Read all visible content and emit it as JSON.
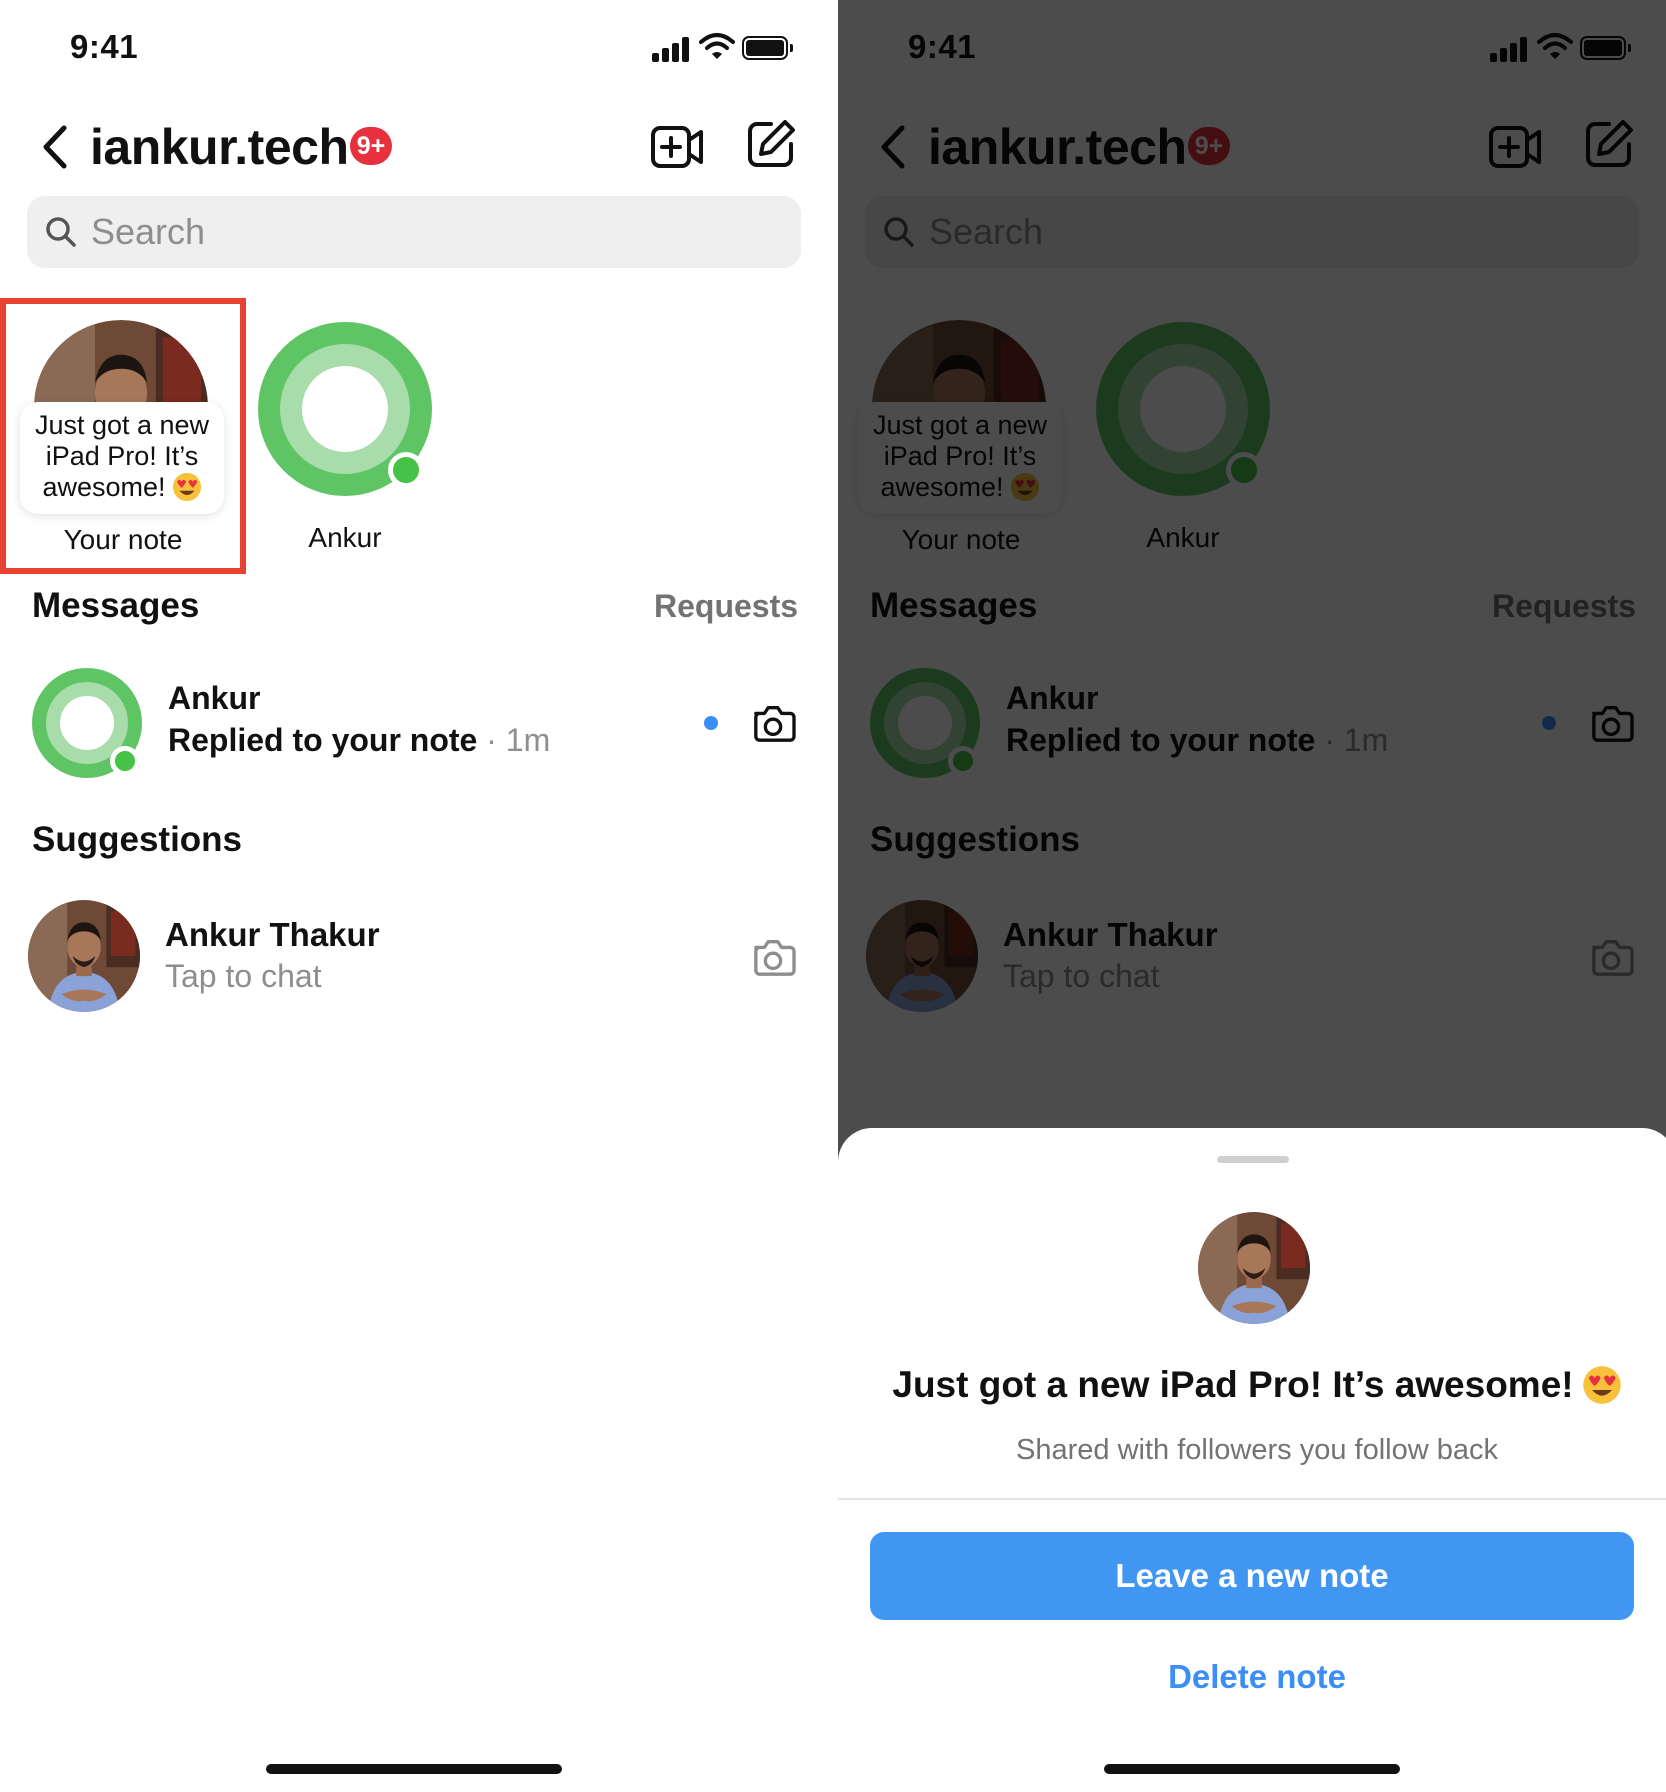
{
  "status_bar": {
    "time": "9:41"
  },
  "header": {
    "title": "iankur.tech",
    "badge": "9+"
  },
  "search": {
    "placeholder": "Search"
  },
  "notes": {
    "your_note_text_lines": [
      "Just got a new",
      "iPad Pro! It’s",
      "awesome!"
    ],
    "your_note_label": "Your note",
    "ankur_label": "Ankur"
  },
  "messages": {
    "title": "Messages",
    "requests_label": "Requests",
    "items": [
      {
        "name": "Ankur",
        "subtitle": "Replied to your note",
        "time": "· 1m"
      }
    ]
  },
  "suggestions": {
    "title": "Suggestions",
    "items": [
      {
        "name": "Ankur Thakur",
        "subtitle": "Tap to chat"
      }
    ]
  },
  "sheet": {
    "note_text": "Just got a new iPad Pro! It’s awesome!",
    "subtitle": "Shared with followers you follow back",
    "primary_button": "Leave a new note",
    "secondary_button": "Delete note"
  },
  "colors": {
    "accent_blue": "#4096f0",
    "badge_red": "#e8313f",
    "online_green": "#46c246",
    "highlight_red": "#e5432e"
  }
}
